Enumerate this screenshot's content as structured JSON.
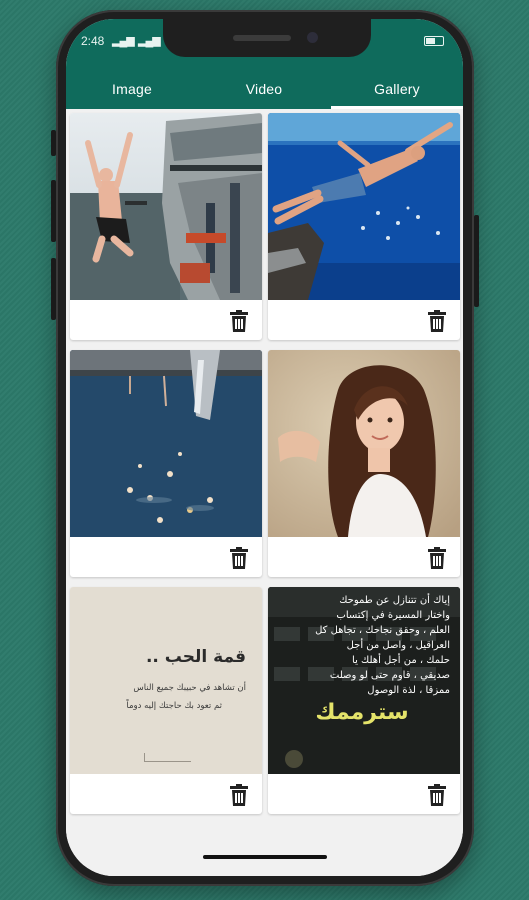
{
  "status_bar": {
    "time": "2:48",
    "signal_icon": "signal-icon",
    "battery_icon": "battery-icon"
  },
  "tabs": [
    {
      "label": "Image",
      "selected": false
    },
    {
      "label": "Video",
      "selected": false
    },
    {
      "label": "Gallery",
      "selected": true
    }
  ],
  "colors": {
    "background": "#2c7a6a",
    "header": "#0f6b5c",
    "tab_indicator": "#ffffff"
  },
  "gallery": {
    "items": [
      {
        "photo": "man-jumping-off-ship",
        "delete_icon": "trash-icon"
      },
      {
        "photo": "man-diving-into-sea",
        "delete_icon": "trash-icon"
      },
      {
        "photo": "swimmers-near-ship",
        "delete_icon": "trash-icon"
      },
      {
        "photo": "girl-portrait",
        "delete_icon": "trash-icon"
      },
      {
        "photo": "arabic-quote-card",
        "delete_icon": "trash-icon",
        "text_title": "قمة الحب ..",
        "text_line1": "أن تشاهد في حبيبك جميع الناس",
        "text_line2": "ثم تعود بك حاجتك إليه دوماً"
      },
      {
        "photo": "arabic-quote-poster",
        "delete_icon": "trash-icon",
        "text_lines": [
          "إياك أن تتنازل عن طموحك",
          "واختار المسيرة في إكتساب",
          "العلم ، وحقق نجاحك ، تجاهل كل",
          "العراقيل ، واصل من أجل",
          "حلمك ، من أجل أهلك يا",
          "صديقي ، قاوم حتى لو وصلت",
          "ممزقا ، لذة الوصول"
        ],
        "text_big": "سترممك"
      }
    ]
  }
}
